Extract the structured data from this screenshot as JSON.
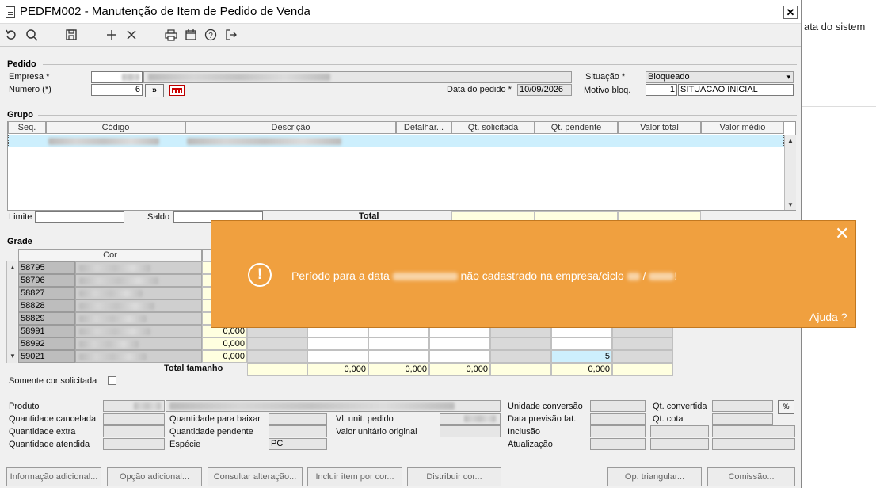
{
  "window": {
    "title": "PEDFM002 - Manutenção de Item de Pedido de Venda",
    "close": "✕"
  },
  "background": {
    "text": "ata do sistem"
  },
  "pedido": {
    "section": "Pedido",
    "empresa_label": "Empresa *",
    "numero_label": "Número (*)",
    "numero_value": "6",
    "numero_btn": "»",
    "data_label": "Data do pedido *",
    "data_value": "10/09/2026",
    "situacao_label": "Situação *",
    "situacao_value": "Bloqueado",
    "motivo_label": "Motivo bloq.",
    "motivo_code": "1",
    "motivo_desc": "SITUACAO INICIAL"
  },
  "grupo": {
    "section": "Grupo",
    "columns": [
      "Seq.",
      "Código",
      "Descrição",
      "Detalhar...",
      "Qt. solicitada",
      "Qt. pendente",
      "Valor total",
      "Valor médio"
    ],
    "limite_label": "Limite",
    "saldo_label": "Saldo",
    "total_label": "Total"
  },
  "grade": {
    "section": "Grade",
    "cor_header": "Cor",
    "colors": [
      "58795",
      "58796",
      "58827",
      "58828",
      "58829",
      "58991",
      "58992",
      "59021"
    ],
    "visible_values": {
      "58991": "0,000",
      "58992": "0,000",
      "59021": "0,000"
    },
    "row_59021_pending": "5",
    "total_label": "Total tamanho",
    "totals": [
      "0,000",
      "0,000",
      "0,000",
      "0,000"
    ],
    "somente_label": "Somente cor solicitada"
  },
  "details": {
    "produto": "Produto",
    "qt_cancelada": "Quantidade cancelada",
    "qt_extra": "Quantidade extra",
    "qt_atendida": "Quantidade atendida",
    "qt_baixar": "Quantidade para baixar",
    "qt_pendente": "Quantidade pendente",
    "especie": "Espécie",
    "especie_value": "PC",
    "vl_unit": "Vl. unit. pedido",
    "vl_unit_orig": "Valor unitário original",
    "unidade_conv": "Unidade conversão",
    "data_prev": "Data previsão fat.",
    "inclusao": "Inclusão",
    "atualizacao": "Atualização",
    "qt_convertida": "Qt. convertida",
    "qt_cota": "Qt. cota"
  },
  "buttons": [
    "Informação adicional...",
    "Opção adicional...",
    "Consultar alteração...",
    "Incluir item por cor...",
    "Distribuir cor...",
    "Op. triangular...",
    "Comissão..."
  ],
  "toast": {
    "msg_a": "Período para a data",
    "msg_b": "não cadastrado na empresa/ciclo",
    "msg_c": "/",
    "msg_d": "!",
    "help": "Ajuda ?",
    "close": "✕"
  }
}
